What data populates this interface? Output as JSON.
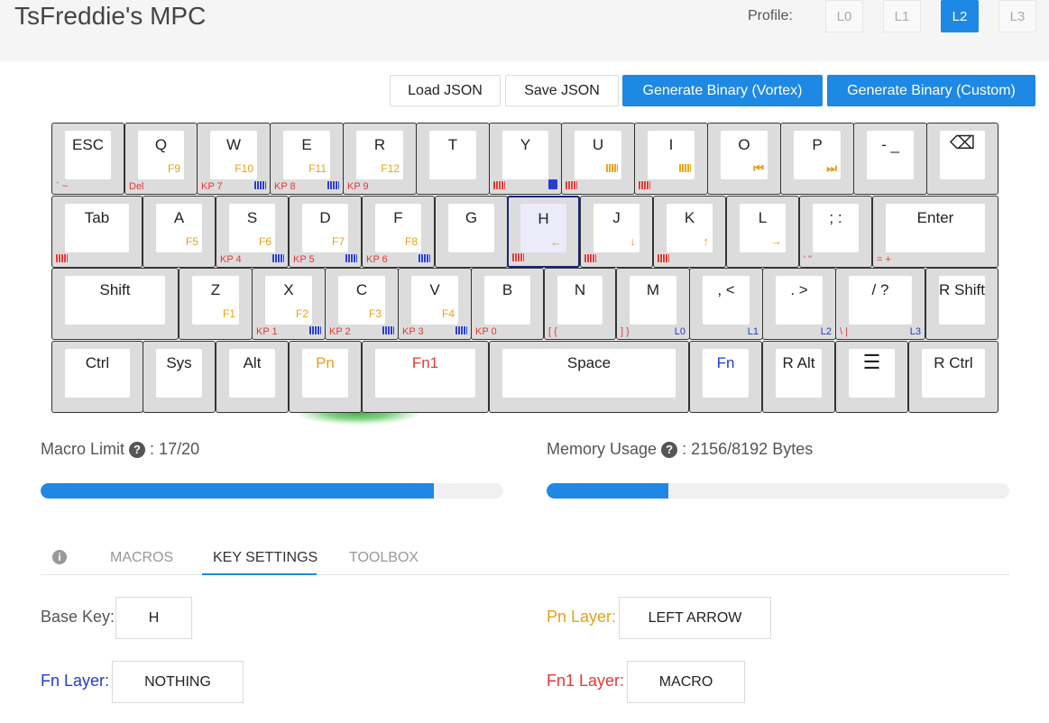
{
  "app": {
    "title": "TsFreddie's MPC"
  },
  "profile": {
    "label": "Profile:",
    "options": [
      "L0",
      "L1",
      "L2",
      "L3"
    ],
    "active": "L2"
  },
  "toolbar": {
    "load": "Load JSON",
    "save": "Save JSON",
    "gen_vortex": "Generate Binary (Vortex)",
    "gen_custom": "Generate Binary (Custom)"
  },
  "colors": {
    "accent": "#1e88e5",
    "pn": "#e6a11a",
    "fn": "#1e3ccf",
    "fn1": "#e53935",
    "selected_border": "#1a237e"
  },
  "keyboard": {
    "selected_key": "H",
    "rows": [
      [
        {
          "main": "ESC",
          "fn1": "` ~"
        },
        {
          "main": "Q",
          "pn": "F9",
          "fn1": "Del"
        },
        {
          "main": "W",
          "pn": "F10",
          "fn1": "KP 7",
          "fn_icon": "keyboard-blue-icon"
        },
        {
          "main": "E",
          "pn": "F11",
          "fn1": "KP 8",
          "fn_icon": "keyboard-blue-icon"
        },
        {
          "main": "R",
          "pn": "F12",
          "fn1": "KP 9"
        },
        {
          "main": "T"
        },
        {
          "main": "Y",
          "fn1_icon": "keyboard-red-icon",
          "fn_icon": "calculator-icon"
        },
        {
          "main": "U",
          "pn_icon": "keyboard-orange-icon",
          "fn1_icon": "keyboard-red-icon"
        },
        {
          "main": "I",
          "pn_icon": "keyboard-orange-icon",
          "fn1_icon": "keyboard-red-icon"
        },
        {
          "main": "O",
          "pn_glyph": "⏮"
        },
        {
          "main": "P",
          "pn_glyph": "⏭"
        },
        {
          "main": "- _"
        },
        {
          "main": "⌫"
        }
      ],
      [
        {
          "main": "Tab",
          "fn1_icon": "keyboard-red-icon"
        },
        {
          "main": "A",
          "pn": "F5"
        },
        {
          "main": "S",
          "pn": "F6",
          "fn1": "KP 4",
          "fn_icon": "keyboard-blue-icon"
        },
        {
          "main": "D",
          "pn": "F7",
          "fn1": "KP 5",
          "fn_icon": "keyboard-blue-icon"
        },
        {
          "main": "F",
          "pn": "F8",
          "fn1": "KP 6",
          "fn_icon": "keyboard-blue-icon"
        },
        {
          "main": "G"
        },
        {
          "main": "H",
          "pn_glyph": "←",
          "fn1_icon": "keyboard-red-icon"
        },
        {
          "main": "J",
          "pn_glyph": "↓",
          "fn1_icon": "keyboard-red-icon"
        },
        {
          "main": "K",
          "pn_glyph": "↑",
          "fn1_icon": "keyboard-red-icon"
        },
        {
          "main": "L",
          "pn_glyph": "→"
        },
        {
          "main": "; :",
          "fn1": "' \""
        },
        {
          "main": "Enter",
          "fn1": "= +"
        }
      ],
      [
        {
          "main": "Shift"
        },
        {
          "main": "Z",
          "pn": "F1"
        },
        {
          "main": "X",
          "pn": "F2",
          "fn1": "KP 1",
          "fn_icon": "keyboard-blue-icon"
        },
        {
          "main": "C",
          "pn": "F3",
          "fn1": "KP 2",
          "fn_icon": "keyboard-blue-icon"
        },
        {
          "main": "V",
          "pn": "F4",
          "fn1": "KP 3",
          "fn_icon": "keyboard-blue-icon"
        },
        {
          "main": "B",
          "fn1": "KP 0"
        },
        {
          "main": "N",
          "fn1": "[ {"
        },
        {
          "main": "M",
          "fn1": "] }",
          "fn": "L0"
        },
        {
          "main": ", <",
          "fn": "L1"
        },
        {
          "main": ". >",
          "fn": "L2"
        },
        {
          "main": "/ ?",
          "fn1": "\\ |",
          "fn": "L3"
        },
        {
          "main": "R Shift"
        }
      ],
      [
        {
          "main": "Ctrl"
        },
        {
          "main": "Sys"
        },
        {
          "main": "Alt"
        },
        {
          "main": "Pn",
          "color": "pn"
        },
        {
          "main": "Fn1",
          "color": "fn1"
        },
        {
          "main": "Space"
        },
        {
          "main": "Fn",
          "color": "fn"
        },
        {
          "main": "R Alt"
        },
        {
          "main": "☰"
        },
        {
          "main": "R Ctrl"
        }
      ]
    ]
  },
  "stats": {
    "macro": {
      "label": "Macro Limit",
      "value": "17/20",
      "fraction": 0.85
    },
    "memory": {
      "label": "Memory Usage",
      "value": "2156/8192 Bytes",
      "fraction": 0.263
    }
  },
  "tabs": {
    "items": [
      "MACROS",
      "KEY SETTINGS",
      "TOOLBOX"
    ],
    "active": "KEY SETTINGS"
  },
  "key_settings": {
    "base_label": "Base Key:",
    "base_value": "H",
    "pn_label": "Pn Layer:",
    "pn_value": "LEFT ARROW",
    "fn_label": "Fn Layer:",
    "fn_value": "NOTHING",
    "fn1_label": "Fn1 Layer:",
    "fn1_value": "MACRO"
  }
}
